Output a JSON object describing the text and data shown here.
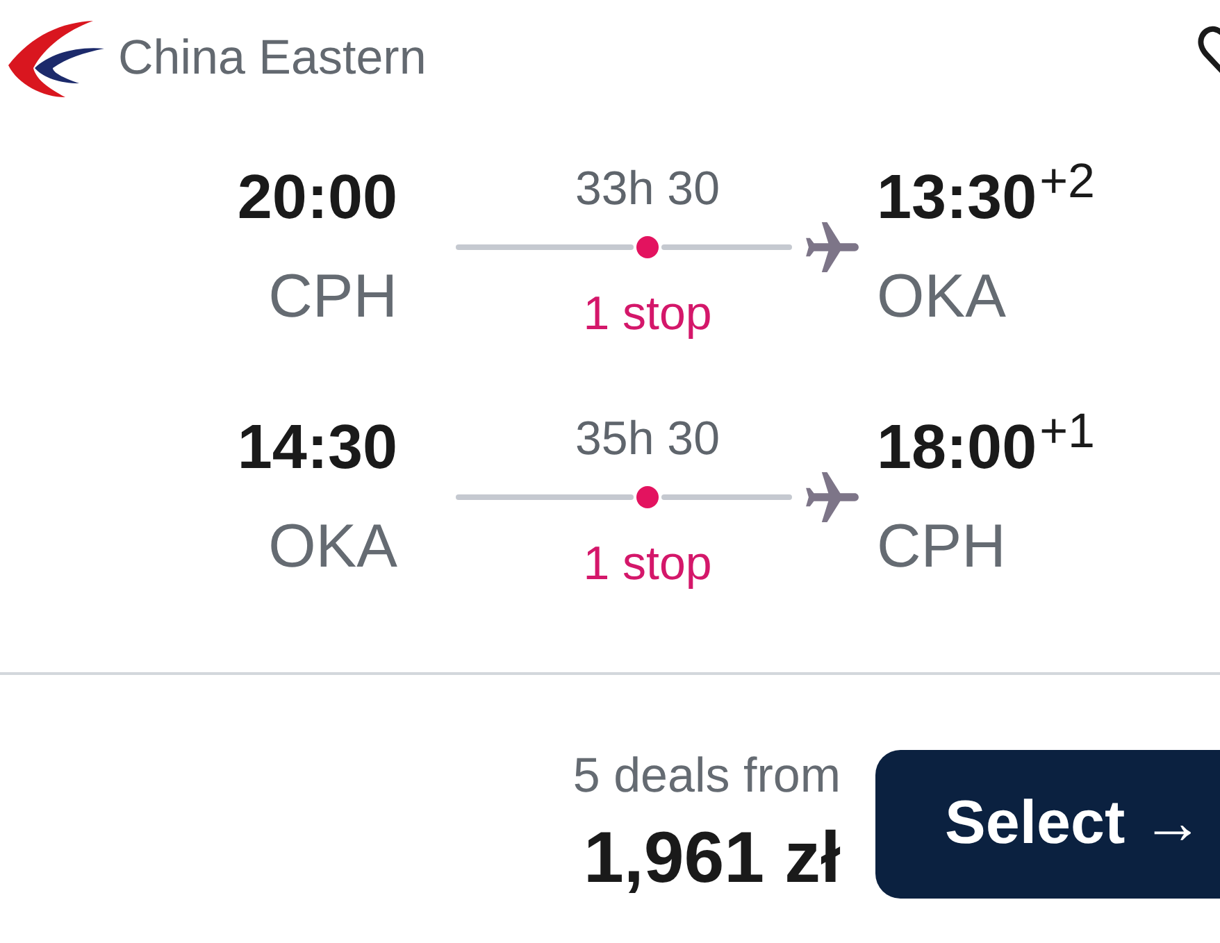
{
  "airline": {
    "name": "China Eastern"
  },
  "favorite": {
    "saved": false
  },
  "legs": [
    {
      "departure": {
        "time": "20:00",
        "airport": "CPH"
      },
      "duration": "33h 30",
      "stops": "1 stop",
      "arrival": {
        "time": "13:30",
        "day_offset": "+2",
        "airport": "OKA"
      }
    },
    {
      "departure": {
        "time": "14:30",
        "airport": "OKA"
      },
      "duration": "35h 30",
      "stops": "1 stop",
      "arrival": {
        "time": "18:00",
        "day_offset": "+1",
        "airport": "CPH"
      }
    }
  ],
  "price": {
    "deals": "5 deals from",
    "amount": "1,961 zł"
  },
  "select_button": {
    "label": "Select →"
  }
}
